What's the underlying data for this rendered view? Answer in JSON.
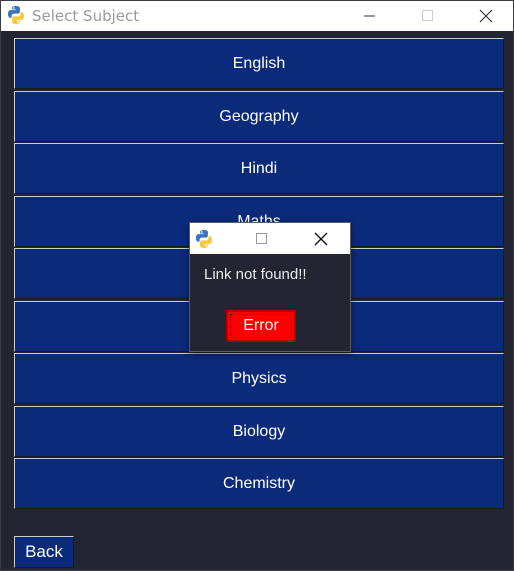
{
  "window": {
    "title": "Select Subject",
    "icon": "python-icon"
  },
  "subjects": [
    {
      "label": "English"
    },
    {
      "label": "Geography"
    },
    {
      "label": "Hindi"
    },
    {
      "label": "Maths"
    },
    {
      "label": ""
    },
    {
      "label": ""
    },
    {
      "label": "Physics"
    },
    {
      "label": "Biology"
    },
    {
      "label": "Chemistry"
    }
  ],
  "footer": {
    "back_label": "Back"
  },
  "dialog": {
    "icon": "python-icon",
    "message": "Link not found!!",
    "button_label": "Error",
    "button_color": "#ff0000"
  },
  "colors": {
    "subject_button_bg": "#0b2a7a",
    "window_bg": "#232632"
  }
}
